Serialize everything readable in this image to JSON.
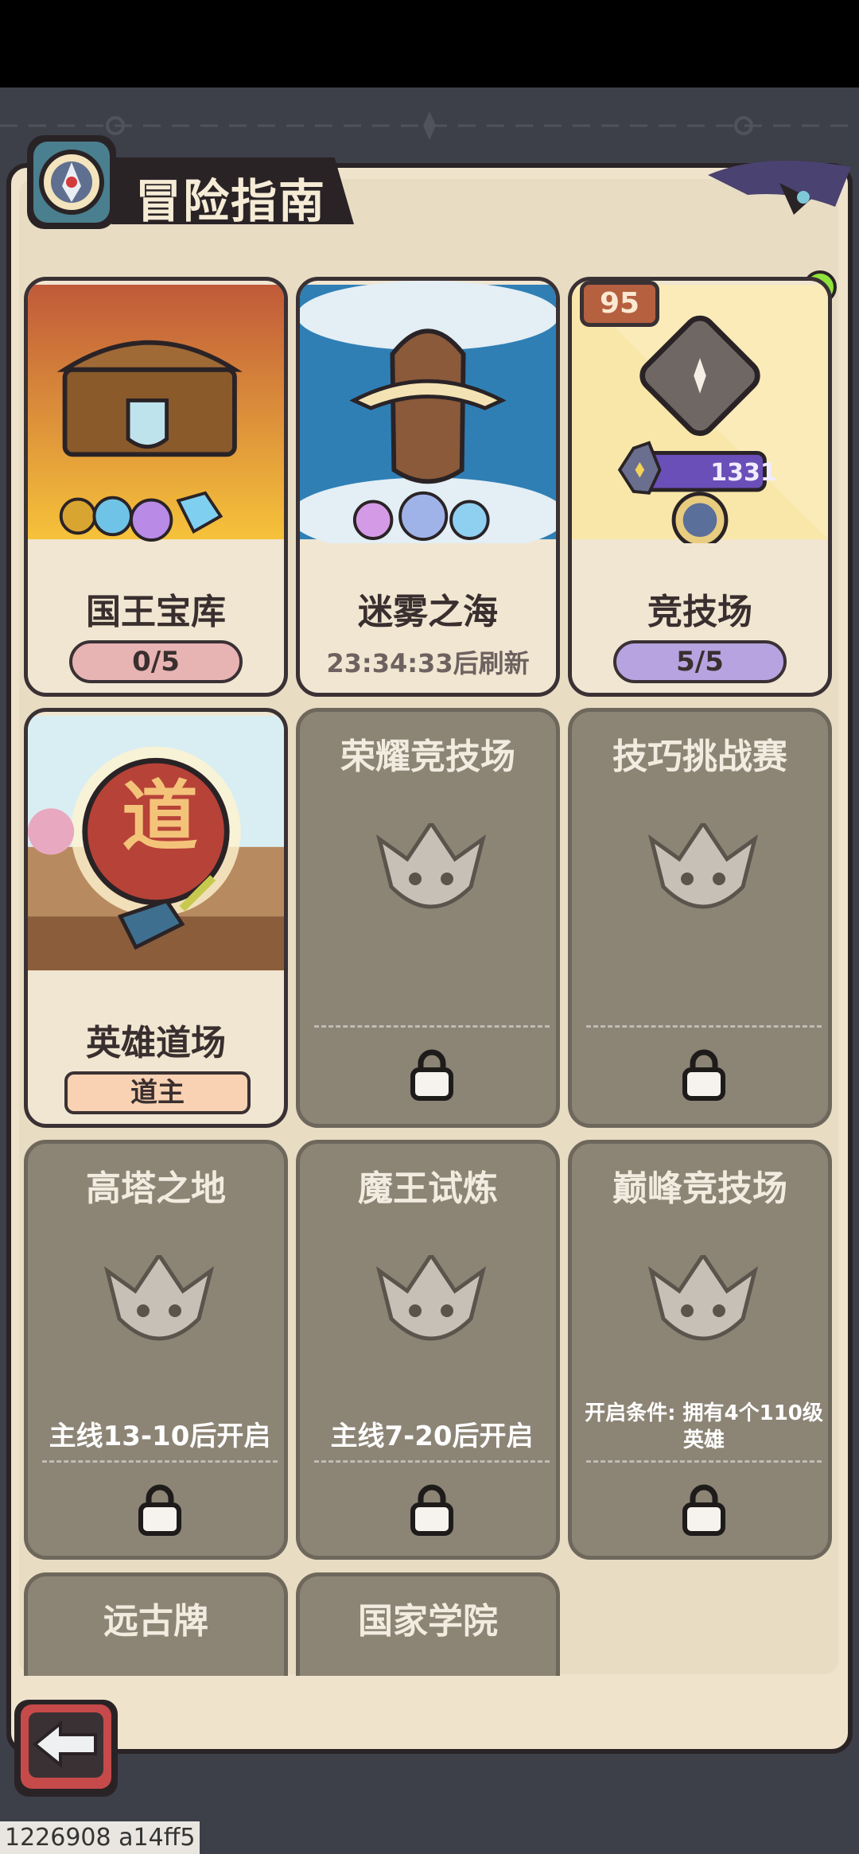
{
  "header": {
    "title": "冒险指南"
  },
  "cards": [
    {
      "title": "国王宝库",
      "progress": "0/5"
    },
    {
      "title": "迷雾之海",
      "refresh": "23:34:33后刷新"
    },
    {
      "title": "竞技场",
      "progress": "5/5",
      "rank": "95",
      "score": "1331"
    },
    {
      "title": "英雄道场",
      "status": "道主",
      "emblem": "道"
    },
    {
      "title": "荣耀竞技场"
    },
    {
      "title": "技巧挑战赛"
    },
    {
      "title": "高塔之地",
      "condition": "主线13-10后开启"
    },
    {
      "title": "魔王试炼",
      "condition": "主线7-20后开启"
    },
    {
      "title": "巅峰竞技场",
      "condition": "开启条件: 拥有4个110级英雄"
    },
    {
      "title": "远古牌"
    },
    {
      "title": "国家学院"
    }
  ],
  "footer": {
    "build_id": "1226908 a14ff5"
  },
  "icons": {
    "back": "back-arrow-icon",
    "lock": "lock-icon",
    "compass": "compass-icon"
  },
  "colors": {
    "panel": "#efe3cc",
    "locked_card": "#8c8475",
    "pill_red": "#e8b3b3",
    "pill_purple": "#b7a3e0",
    "online_dot": "#8fe33b"
  }
}
